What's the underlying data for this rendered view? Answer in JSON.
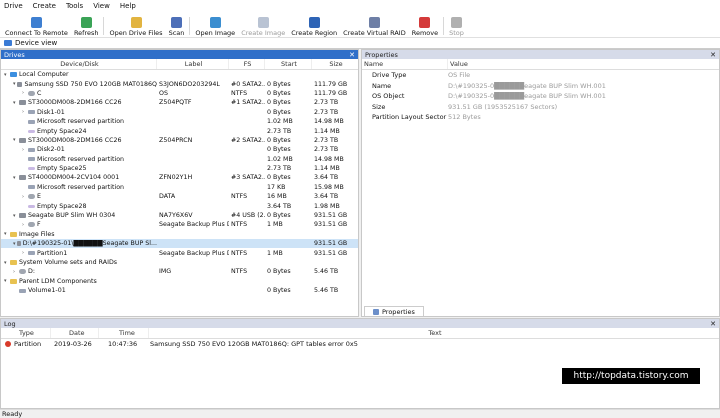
{
  "menu": [
    "Drive",
    "Create",
    "Tools",
    "View",
    "Help"
  ],
  "toolbar": [
    {
      "label": "Connect To Remote",
      "icon": "connect-icon",
      "color": "#3e7fd1",
      "enabled": true
    },
    {
      "label": "Refresh",
      "icon": "refresh-icon",
      "color": "#3aa356",
      "enabled": true
    },
    {
      "label": "Open Drive Files",
      "icon": "folder-icon",
      "color": "#e2b440",
      "enabled": true
    },
    {
      "label": "Scan",
      "icon": "scan-icon",
      "color": "#4d6fb8",
      "enabled": true
    },
    {
      "label": "Open Image",
      "icon": "open-image-icon",
      "color": "#3b8ed0",
      "enabled": true
    },
    {
      "label": "Create Image",
      "icon": "create-image-icon",
      "color": "#b9c3d3",
      "enabled": false
    },
    {
      "label": "Create Region",
      "icon": "create-region-icon",
      "color": "#2e64b6",
      "enabled": true
    },
    {
      "label": "Create Virtual RAID",
      "icon": "raid-icon",
      "color": "#6e7fa6",
      "enabled": true
    },
    {
      "label": "Remove",
      "icon": "remove-icon",
      "color": "#d43a3a",
      "enabled": true
    },
    {
      "label": "Stop",
      "icon": "stop-icon",
      "color": "#b0b0b0",
      "enabled": false
    }
  ],
  "device_view_tab": "Device view",
  "drives_panel": {
    "title": "Drives",
    "close": "✕",
    "columns": [
      "Device/Disk",
      "Label",
      "FS",
      "Start",
      "Size"
    ],
    "rows": [
      {
        "indent": 0,
        "arrow": "▾",
        "icon": "pc",
        "name": "Local Computer",
        "label": "",
        "fs": "",
        "start": "",
        "size": "",
        "sel": false
      },
      {
        "indent": 1,
        "arrow": "▾",
        "icon": "disk",
        "name": "Samsung SSD 750 EVO 120GB MAT0186Q",
        "label": "S3JON6DO203294L",
        "fs": "#0 SATA2...",
        "start": "0 Bytes",
        "size": "111.79 GB",
        "sel": false
      },
      {
        "indent": 2,
        "arrow": "›",
        "icon": "vol",
        "name": "C",
        "label": "OS",
        "fs": "NTFS",
        "start": "0 Bytes",
        "size": "111.79 GB",
        "sel": false
      },
      {
        "indent": 1,
        "arrow": "▾",
        "icon": "disk",
        "name": "ST3000DM008-2DM166 CC26",
        "label": "Z504PQTF",
        "fs": "#1 SATA2...",
        "start": "0 Bytes",
        "size": "2.73 TB",
        "sel": false
      },
      {
        "indent": 2,
        "arrow": "›",
        "icon": "part",
        "name": "Disk1-01",
        "label": "",
        "fs": "",
        "start": "0 Bytes",
        "size": "2.73 TB",
        "sel": false
      },
      {
        "indent": 2,
        "arrow": "",
        "icon": "part",
        "name": "Microsoft reserved partition",
        "label": "",
        "fs": "",
        "start": "1.02 MB",
        "size": "14.98 MB",
        "sel": false
      },
      {
        "indent": 2,
        "arrow": "",
        "icon": "empty",
        "name": "Empty Space24",
        "label": "",
        "fs": "",
        "start": "2.73 TB",
        "size": "1.14 MB",
        "sel": false
      },
      {
        "indent": 1,
        "arrow": "▾",
        "icon": "disk",
        "name": "ST3000DM008-2DM166 CC26",
        "label": "Z504PRCN",
        "fs": "#2 SATA2...",
        "start": "0 Bytes",
        "size": "2.73 TB",
        "sel": false
      },
      {
        "indent": 2,
        "arrow": "›",
        "icon": "part",
        "name": "Disk2-01",
        "label": "",
        "fs": "",
        "start": "0 Bytes",
        "size": "2.73 TB",
        "sel": false
      },
      {
        "indent": 2,
        "arrow": "",
        "icon": "part",
        "name": "Microsoft reserved partition",
        "label": "",
        "fs": "",
        "start": "1.02 MB",
        "size": "14.98 MB",
        "sel": false
      },
      {
        "indent": 2,
        "arrow": "",
        "icon": "empty",
        "name": "Empty Space25",
        "label": "",
        "fs": "",
        "start": "2.73 TB",
        "size": "1.14 MB",
        "sel": false
      },
      {
        "indent": 1,
        "arrow": "▾",
        "icon": "disk",
        "name": "ST4000DM004-2CV104 0001",
        "label": "ZFN02Y1H",
        "fs": "#3 SATA2...",
        "start": "0 Bytes",
        "size": "3.64 TB",
        "sel": false
      },
      {
        "indent": 2,
        "arrow": "",
        "icon": "part",
        "name": "Microsoft reserved partition",
        "label": "",
        "fs": "",
        "start": "17 KB",
        "size": "15.98 MB",
        "sel": false
      },
      {
        "indent": 2,
        "arrow": "›",
        "icon": "vol",
        "name": "E",
        "label": "DATA",
        "fs": "NTFS",
        "start": "16 MB",
        "size": "3.64 TB",
        "sel": false
      },
      {
        "indent": 2,
        "arrow": "",
        "icon": "empty",
        "name": "Empty Space28",
        "label": "",
        "fs": "",
        "start": "3.64 TB",
        "size": "1.98 MB",
        "sel": false
      },
      {
        "indent": 1,
        "arrow": "▾",
        "icon": "disk",
        "name": "Seagate BUP Slim WH 0304",
        "label": "NA7Y6X6V",
        "fs": "#4 USB (2...",
        "start": "0 Bytes",
        "size": "931.51 GB",
        "sel": false
      },
      {
        "indent": 2,
        "arrow": "›",
        "icon": "vol",
        "name": "F",
        "label": "Seagate Backup Plus D...",
        "fs": "NTFS",
        "start": "1 MB",
        "size": "931.51 GB",
        "sel": false
      },
      {
        "indent": 0,
        "arrow": "▾",
        "icon": "folder",
        "name": "Image Files",
        "label": "",
        "fs": "",
        "start": "",
        "size": "",
        "sel": false
      },
      {
        "indent": 1,
        "arrow": "▾",
        "icon": "disk",
        "name": "D:\\#190325-01\\██████Seagate BUP Sl...",
        "label": "",
        "fs": "",
        "start": "",
        "size": "931.51 GB",
        "sel": true
      },
      {
        "indent": 2,
        "arrow": "›",
        "icon": "part",
        "name": "Partition1",
        "label": "Seagate Backup Plus D...",
        "fs": "NTFS",
        "start": "1 MB",
        "size": "931.51 GB",
        "sel": false
      },
      {
        "indent": 0,
        "arrow": "▾",
        "icon": "folder",
        "name": "System Volume sets and RAIDs",
        "label": "",
        "fs": "",
        "start": "",
        "size": "",
        "sel": false
      },
      {
        "indent": 1,
        "arrow": "›",
        "icon": "vol",
        "name": "D:",
        "label": "IMG",
        "fs": "NTFS",
        "start": "0 Bytes",
        "size": "5.46 TB",
        "sel": false
      },
      {
        "indent": 0,
        "arrow": "▾",
        "icon": "folder",
        "name": "Parent LDM Components",
        "label": "",
        "fs": "",
        "start": "",
        "size": "",
        "sel": false
      },
      {
        "indent": 1,
        "arrow": "",
        "icon": "part",
        "name": "Volume1-01",
        "label": "",
        "fs": "",
        "start": "0 Bytes",
        "size": "5.46 TB",
        "sel": false
      }
    ]
  },
  "properties_panel": {
    "title": "Properties",
    "close": "✕",
    "columns": [
      "Name",
      "Value"
    ],
    "rows": [
      {
        "name": "Drive Type",
        "value": "OS File"
      },
      {
        "name": "Name",
        "value": "D:\\#190325-0██████eagate BUP Slim WH.001"
      },
      {
        "name": "OS Object",
        "value": "D:\\#190325-0██████eagate BUP Slim WH.001"
      },
      {
        "name": "Size",
        "value": "931.51 GB (1953525167 Sectors)"
      },
      {
        "name": "Partition Layout Sector Size",
        "value": "512 Bytes"
      }
    ],
    "tab": "Properties"
  },
  "log_panel": {
    "title": "Log",
    "close": "✕",
    "columns": [
      "Type",
      "Date",
      "Time",
      "Text"
    ],
    "rows": [
      {
        "type": "Partition",
        "date": "2019-03-26",
        "time": "10:47:36",
        "text": "Samsung SSD 750 EVO 120GB MAT0186Q: GPT tables error 0x5"
      }
    ]
  },
  "watermark": "http://topdata.tistory.com",
  "status": "Ready",
  "colors": {
    "accent": "#2f6fc9",
    "selection": "#cde3f7",
    "error": "#d93b2b"
  }
}
